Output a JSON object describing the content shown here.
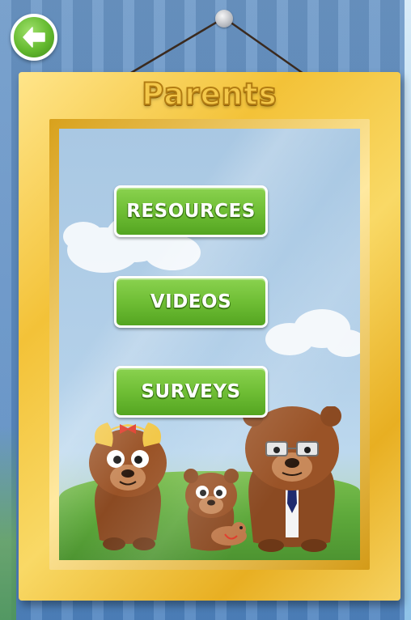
{
  "page": {
    "title": "Parents"
  },
  "menu": {
    "items": [
      {
        "label": "RESOURCES"
      },
      {
        "label": "VIDEOS"
      },
      {
        "label": "SURVEYS"
      }
    ]
  },
  "icons": {
    "back": "back-arrow-icon"
  },
  "colors": {
    "button_green": "#6fbe35",
    "frame_gold": "#f3c238",
    "wall_blue": "#5d8dc3"
  }
}
